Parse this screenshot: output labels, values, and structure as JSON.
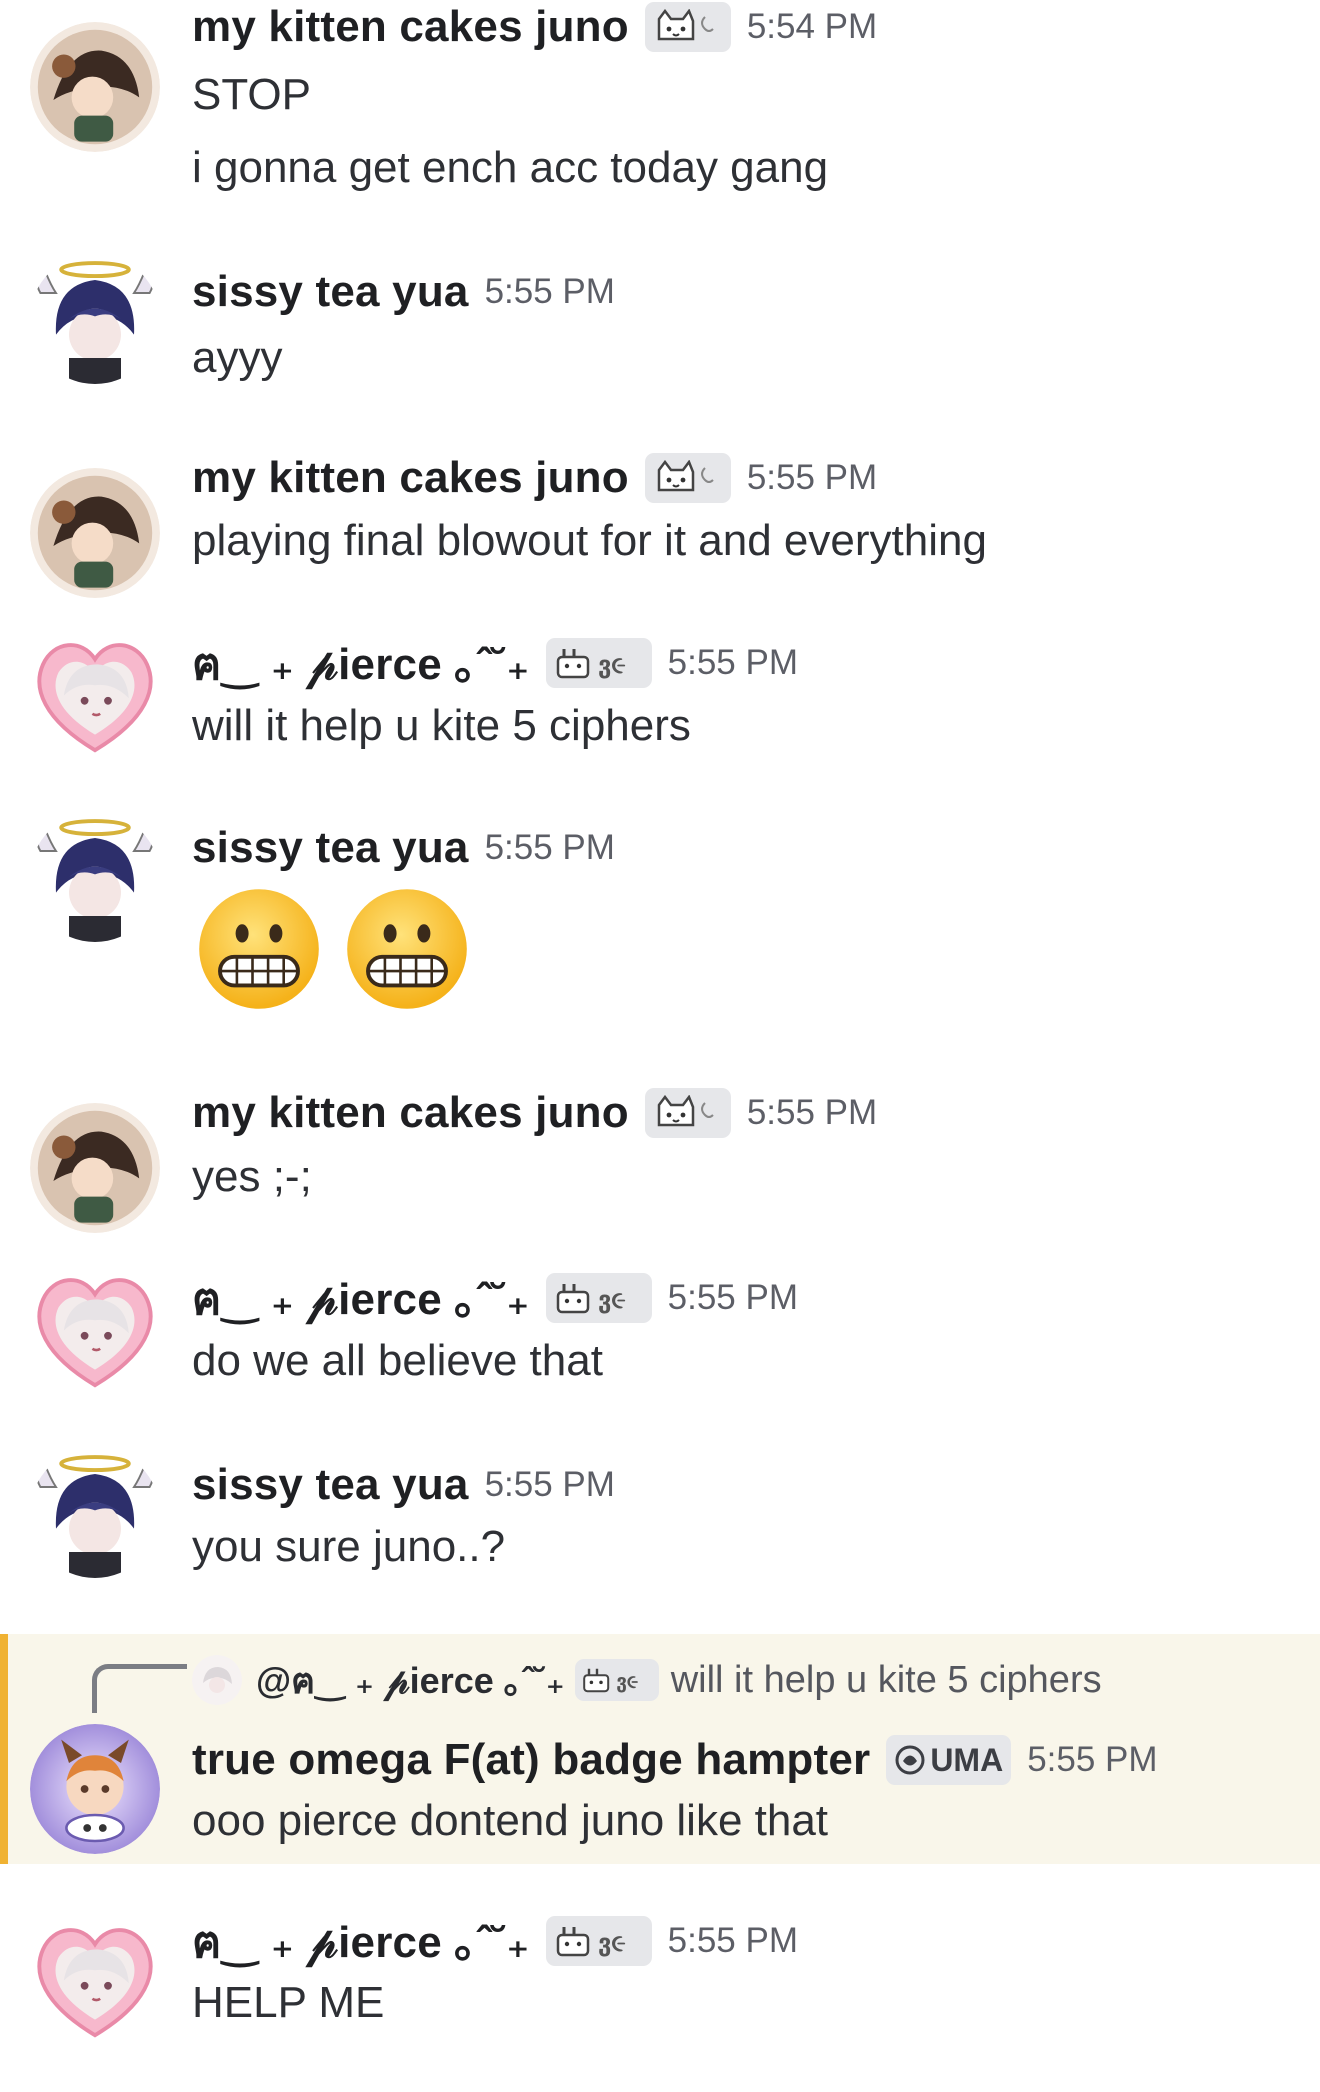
{
  "messages": [
    {
      "author": "my kitten cakes juno",
      "time": "5:54 PM",
      "lines": [
        "STOP",
        "i gonna get ench acc today gang"
      ]
    },
    {
      "author": "sissy tea yua",
      "time": "5:55 PM",
      "lines": [
        "ayyy"
      ]
    },
    {
      "author": "my kitten cakes juno",
      "time": "5:55 PM",
      "lines": [
        "playing final blowout for it and everything"
      ]
    },
    {
      "author": "ฅ‿ ₊ 𝓅ierce ｡ˆ˘₊",
      "time": "5:55 PM",
      "lines": [
        "will it help u kite 5 ciphers"
      ]
    },
    {
      "author": "sissy tea yua",
      "time": "5:55 PM",
      "emoji": [
        "😬",
        "😬"
      ]
    },
    {
      "author": "my kitten cakes juno",
      "time": "5:55 PM",
      "lines": [
        "yes ;-;"
      ]
    },
    {
      "author": "ฅ‿ ₊ 𝓅ierce ｡ˆ˘₊",
      "time": "5:55 PM",
      "lines": [
        "do we all believe that"
      ]
    },
    {
      "author": "sissy tea yua",
      "time": "5:55 PM",
      "lines": [
        "you sure juno..?"
      ]
    },
    {
      "author": "true omega F(at) badge hampter",
      "tag": "UMA",
      "time": "5:55 PM",
      "lines": [
        "ooo pierce dontend juno like that"
      ],
      "reply_to": {
        "author": "@ฅ‿ ₊ 𝓅ierce ｡ˆ˘₊",
        "text": "will it help u kite 5 ciphers"
      }
    },
    {
      "author": "ฅ‿ ₊ 𝓅ierce ｡ˆ˘₊",
      "time": "5:55 PM",
      "lines": [
        "HELP ME"
      ]
    }
  ],
  "colors": {
    "background": "#ffffff",
    "name": "#1f2023",
    "text": "#2e3035",
    "timestamp": "#5c5e66",
    "tag_bg": "#e6e7ea",
    "reply_highlight": "#f9f6ea",
    "reply_accent": "#f0b232"
  },
  "icons": {
    "juno_tag": "cat-face-icon",
    "pierce_tag": "bunny-face-icon",
    "uma_tag": "shield-badge-icon",
    "grimace": "grimacing-face-emoji"
  }
}
